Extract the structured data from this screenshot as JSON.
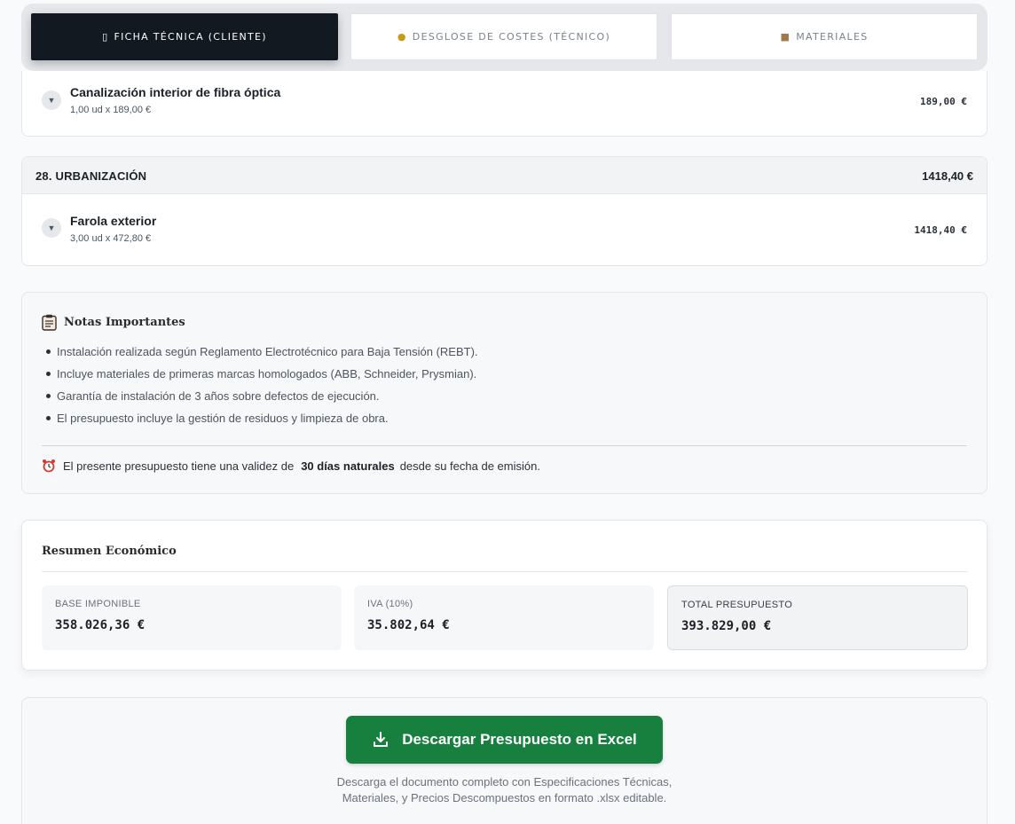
{
  "tabs": [
    {
      "label": "FICHA TÉCNICA (CLIENTE)",
      "icon": "clipboard-icon",
      "active": true
    },
    {
      "label": "DESGLOSE DE COSTES (TÉCNICO)",
      "icon": "money-bag-icon",
      "active": false
    },
    {
      "label": "MATERIALES",
      "icon": "box-icon",
      "active": false
    }
  ],
  "prev_item": {
    "name": "Canalización interior de fibra óptica",
    "detail": "1,00 ud x 189,00 €",
    "price": "189,00 €"
  },
  "section": {
    "title": "28. URBANIZACIÓN",
    "total": "1418,40 €",
    "item": {
      "name": "Farola exterior",
      "detail": "3,00 ud x 472,80 €",
      "price": "1418,40 €"
    }
  },
  "notes": {
    "title": "Notas Importantes",
    "items": [
      "Instalación realizada según Reglamento Electrotécnico para Baja Tensión (REBT).",
      "Incluye materiales de primeras marcas homologados (ABB, Schneider, Prysmian).",
      "Garantía de instalación de 3 años sobre defectos de ejecución.",
      "El presupuesto incluye la gestión de residuos y limpieza de obra."
    ],
    "validity_prefix": "El presente presupuesto tiene una validez de",
    "validity_bold": "30 días naturales",
    "validity_suffix": "desde su fecha de emisión."
  },
  "summary": {
    "title": "Resumen Económico",
    "base_label": "BASE IMPONIBLE",
    "base_value": "358.026,36 €",
    "iva_label": "IVA (10%)",
    "iva_value": "35.802,64 €",
    "total_label": "TOTAL PRESUPUESTO",
    "total_value": "393.829,00 €"
  },
  "download": {
    "button_label": "Descargar Presupuesto en Excel",
    "description": "Descarga el documento completo con Especificaciones Técnicas, Materiales, y Precios Descompuestos en formato .xlsx editable."
  },
  "colors": {
    "accent_green": "#17803f",
    "tab_active": "#121920"
  }
}
